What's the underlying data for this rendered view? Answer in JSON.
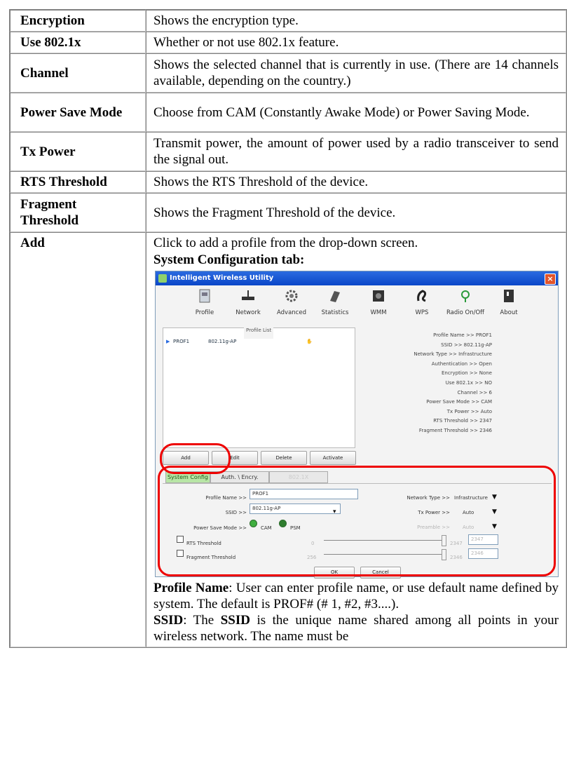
{
  "rows": [
    {
      "key": "Encryption",
      "value": "Shows the encryption type."
    },
    {
      "key": "Use 802.1x",
      "value": "Whether or not use 802.1x feature."
    },
    {
      "key": "Channel",
      "value": "Shows the selected channel that is currently in use. (There are 14 channels available, depending on the country.)"
    },
    {
      "key": "Power Save Mode",
      "value": "Choose from CAM (Constantly Awake Mode) or Power Saving Mode."
    },
    {
      "key": "Tx Power",
      "value": "Transmit power, the amount of power used by a radio transceiver to send the signal out."
    },
    {
      "key": "RTS Threshold",
      "value": "Shows the RTS Threshold of the device."
    },
    {
      "key": "Fragment Threshold",
      "value": "Shows the Fragment Threshold of the device."
    }
  ],
  "add": {
    "key": "Add",
    "intro": "Click to add a profile from the drop-down screen.",
    "subheading": "System Configuration tab:",
    "profile_name_label": "Profile Name",
    "profile_name_text": ": User can enter profile name, or use default name defined by system. The default is PROF# (# 1, #2, #3....).",
    "ssid_label": "SSID",
    "ssid_text_a": ": The ",
    "ssid_text_b": " is the unique name shared among all points in your wireless network. The name must be"
  },
  "window": {
    "title": "Intelligent Wireless Utility",
    "close": "×",
    "toolbar": [
      "Profile",
      "Network",
      "Advanced",
      "Statistics",
      "WMM",
      "WPS",
      "Radio On/Off",
      "About"
    ],
    "profile_list_header": "Profile List",
    "profile_row": {
      "name": "PROF1",
      "ssid": "802.11g-AP"
    },
    "details": [
      "Profile Name >> PROF1",
      "SSID >> 802.11g-AP",
      "Network Type >> Infrastructure",
      "Authentication >> Open",
      "Encryption >> None",
      "Use 802.1x >> NO",
      "Channel >> 6",
      "Power Save Mode >> CAM",
      "Tx Power >> Auto",
      "RTS Threshold >> 2347",
      "Fragment Threshold >> 2346"
    ],
    "buttons": [
      "Add",
      "Edit",
      "Delete",
      "Activate"
    ],
    "tabs": [
      "System Config",
      "Auth. \\ Encry.",
      "802.1X"
    ],
    "form": {
      "profile_name_label": "Profile Name >>",
      "profile_name_value": "PROF1",
      "ssid_label": "SSID >>",
      "ssid_value": "802.11g-AP",
      "power_save_label": "Power Save Mode >>",
      "cam": "CAM",
      "psm": "PSM",
      "network_type_label": "Network Type >>",
      "network_type_value": "Infrastructure",
      "tx_power_label": "Tx Power >>",
      "tx_power_value": "Auto",
      "preamble_label": "Preamble >>",
      "preamble_value": "Auto",
      "rts_label": "RTS Threshold",
      "rts_min": "0",
      "rts_max": "2347",
      "rts_value": "2347",
      "frag_label": "Fragment Threshold",
      "frag_min": "256",
      "frag_max": "2346",
      "frag_value": "2346",
      "ok": "OK",
      "cancel": "Cancel"
    }
  }
}
